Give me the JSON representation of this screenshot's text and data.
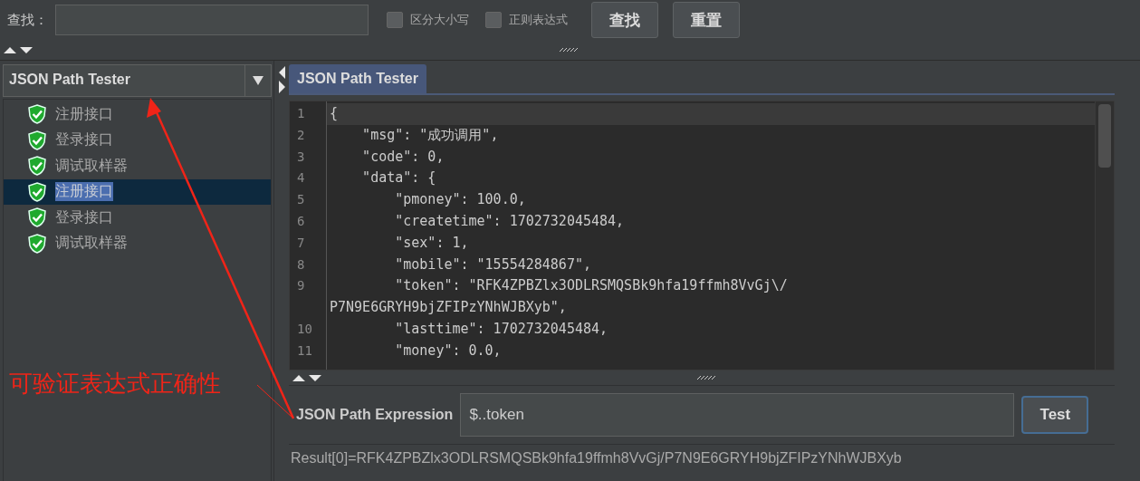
{
  "search_bar": {
    "label": "查找：",
    "options": [
      {
        "label": "区分大小写",
        "checked": false
      },
      {
        "label": "正则表达式",
        "checked": false
      }
    ],
    "buttons": [
      "查找",
      "重置"
    ]
  },
  "tree": {
    "selector": "JSON Path Tester",
    "items": [
      {
        "label": "注册接口",
        "selected": false
      },
      {
        "label": "登录接口",
        "selected": false
      },
      {
        "label": "调试取样器",
        "selected": false
      },
      {
        "label": "注册接口",
        "selected": true
      },
      {
        "label": "登录接口",
        "selected": false
      },
      {
        "label": "调试取样器",
        "selected": false
      }
    ]
  },
  "tabs": [
    {
      "label": "JSON Path Tester",
      "selected": true
    }
  ],
  "editor": {
    "lines": [
      {
        "number": "1",
        "text": "{",
        "current": true
      },
      {
        "number": "2",
        "text": "    \"msg\": \"成功调用\",",
        "current": false
      },
      {
        "number": "3",
        "text": "    \"code\": 0,",
        "current": false
      },
      {
        "number": "4",
        "text": "    \"data\": {",
        "current": false
      },
      {
        "number": "5",
        "text": "        \"pmoney\": 100.0,",
        "current": false
      },
      {
        "number": "6",
        "text": "        \"createtime\": 1702732045484,",
        "current": false
      },
      {
        "number": "7",
        "text": "        \"sex\": 1,",
        "current": false
      },
      {
        "number": "8",
        "text": "        \"mobile\": \"15554284867\",",
        "current": false
      },
      {
        "number": "9",
        "text": "        \"token\": \"RFK4ZPBZlx3ODLRSMQSBk9hfa19ffmh8VvGj\\/",
        "current": false
      },
      {
        "text": "P7N9E6GRYH9bjZFIPzYNhWJBXyb\",",
        "current": false
      },
      {
        "number": "10",
        "text": "        \"lasttime\": 1702732045484,",
        "current": false
      },
      {
        "number": "11",
        "text": "        \"money\": 0.0,",
        "current": false
      }
    ]
  },
  "expression": {
    "label": "JSON Path Expression",
    "value": "$..token",
    "button": "Test"
  },
  "result": "Result[0]=RFK4ZPBZlx3ODLRSMQSBk9hfa19ffmh8VvGj/P7N9E6GRYH9bjZFIPzYNhWJBXyb",
  "annotation": {
    "text": "可验证表达式正确性"
  }
}
